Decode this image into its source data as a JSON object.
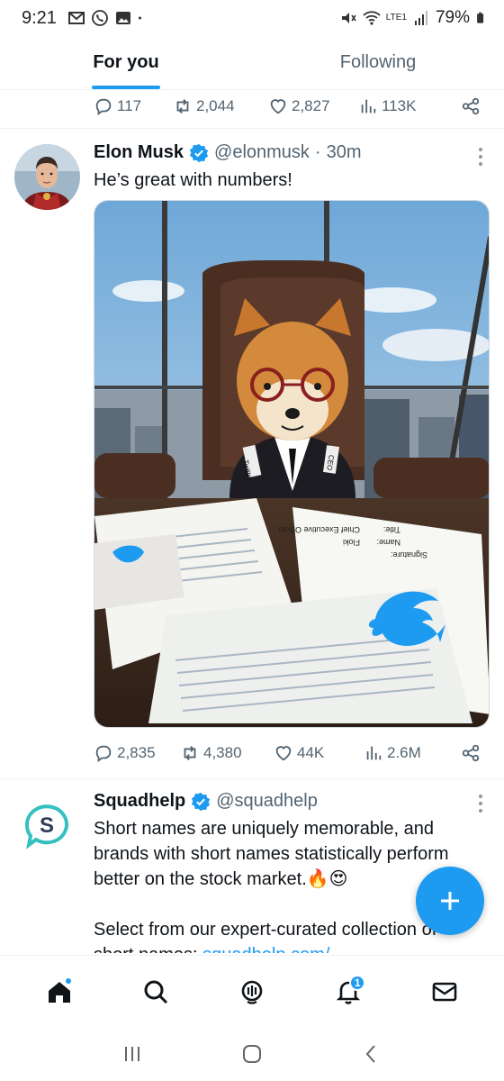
{
  "status_bar": {
    "time": "9:21",
    "battery": "79%",
    "network": "LTE1"
  },
  "tabs": [
    {
      "label": "For you",
      "active": true
    },
    {
      "label": "Following",
      "active": false
    }
  ],
  "previous_tweet": {
    "replies": "117",
    "retweets": "2,044",
    "likes": "2,827",
    "views": "113K"
  },
  "tweets": [
    {
      "name": "Elon Musk",
      "handle": "@elonmusk",
      "separator": "·",
      "time": "30m",
      "text": "He’s great with numbers!",
      "media_alt": "shiba-inu-ceo-photo",
      "replies": "2,835",
      "retweets": "4,380",
      "likes": "44K",
      "views": "2.6M"
    },
    {
      "name": "Squadhelp",
      "handle": "@squadhelp",
      "text_1": "Short names are uniquely memorable, and brands with short names statistically perform better on the stock market.",
      "emoji": "🔥😍",
      "text_2": "Select from our expert-curated collection of",
      "text_3_prefix": "short names:",
      "link": "squadhelp.com/"
    }
  ],
  "document_text": {
    "signature": "Signature:",
    "name_label": "Name:",
    "name_value": "Floki",
    "title_label": "Title:",
    "title_value": "Chief Executive Officer",
    "badge_left": "Twitter",
    "badge_right": "CEO"
  },
  "bottom_nav": {
    "notifications_badge": "1"
  },
  "colors": {
    "accent": "#1d9bf0",
    "text": "#0f1419",
    "muted": "#536471"
  }
}
